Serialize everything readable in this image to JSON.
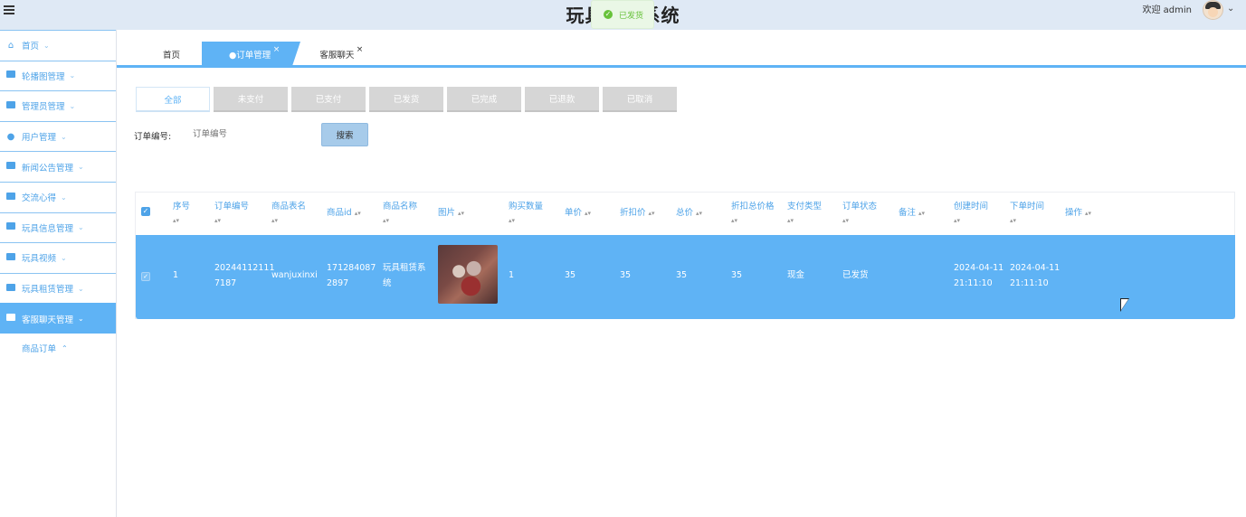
{
  "header": {
    "title": "玩具租赁系统",
    "welcome": "欢迎 admin",
    "toast": "已发货"
  },
  "sidebar": {
    "items": [
      {
        "label": "首页",
        "icon": "home-icon"
      },
      {
        "label": "轮播图管理",
        "icon": "carousel-icon"
      },
      {
        "label": "管理员管理",
        "icon": "table-icon"
      },
      {
        "label": "用户管理",
        "icon": "user-icon"
      },
      {
        "label": "新闻公告管理",
        "icon": "news-icon"
      },
      {
        "label": "交流心得",
        "icon": "briefcase-icon"
      },
      {
        "label": "玩具信息管理",
        "icon": "grid-icon"
      },
      {
        "label": "玩具视频",
        "icon": "grid-icon"
      },
      {
        "label": "玩具租赁管理",
        "icon": "briefcase-icon"
      },
      {
        "label": "客服聊天管理",
        "icon": "apps-icon"
      }
    ],
    "sub_item": "商品订单"
  },
  "tabs": [
    {
      "label": "首页"
    },
    {
      "label": "●订单管理"
    },
    {
      "label": "客服聊天"
    }
  ],
  "status_filters": [
    "全部",
    "未支付",
    "已支付",
    "已发货",
    "已完成",
    "已退款",
    "已取消"
  ],
  "search": {
    "label": "订单编号:",
    "placeholder": "订单编号",
    "button": "搜索"
  },
  "table": {
    "headers": [
      "序号",
      "订单编号",
      "商品表名",
      "商品id",
      "商品名称",
      "图片",
      "购买数量",
      "单价",
      "折扣价",
      "总价",
      "折扣总价格",
      "支付类型",
      "订单状态",
      "备注",
      "创建时间",
      "下单时间",
      "操作"
    ],
    "row": {
      "index": "1",
      "order_no_1": "20244112111",
      "order_no_2": "7187",
      "table_name": "wanjuxinxi",
      "product_id_1": "171284087",
      "product_id_2": "2897",
      "product_name_1": "玩具租赁系",
      "product_name_2": "统",
      "quantity": "1",
      "price": "35",
      "discount_price": "35",
      "total": "35",
      "discount_total": "35",
      "pay_type": "现金",
      "status": "已发货",
      "create_date": "2024-04-11",
      "create_time": "21:11:10",
      "order_date": "2024-04-11",
      "order_time": "21:11:10"
    }
  }
}
